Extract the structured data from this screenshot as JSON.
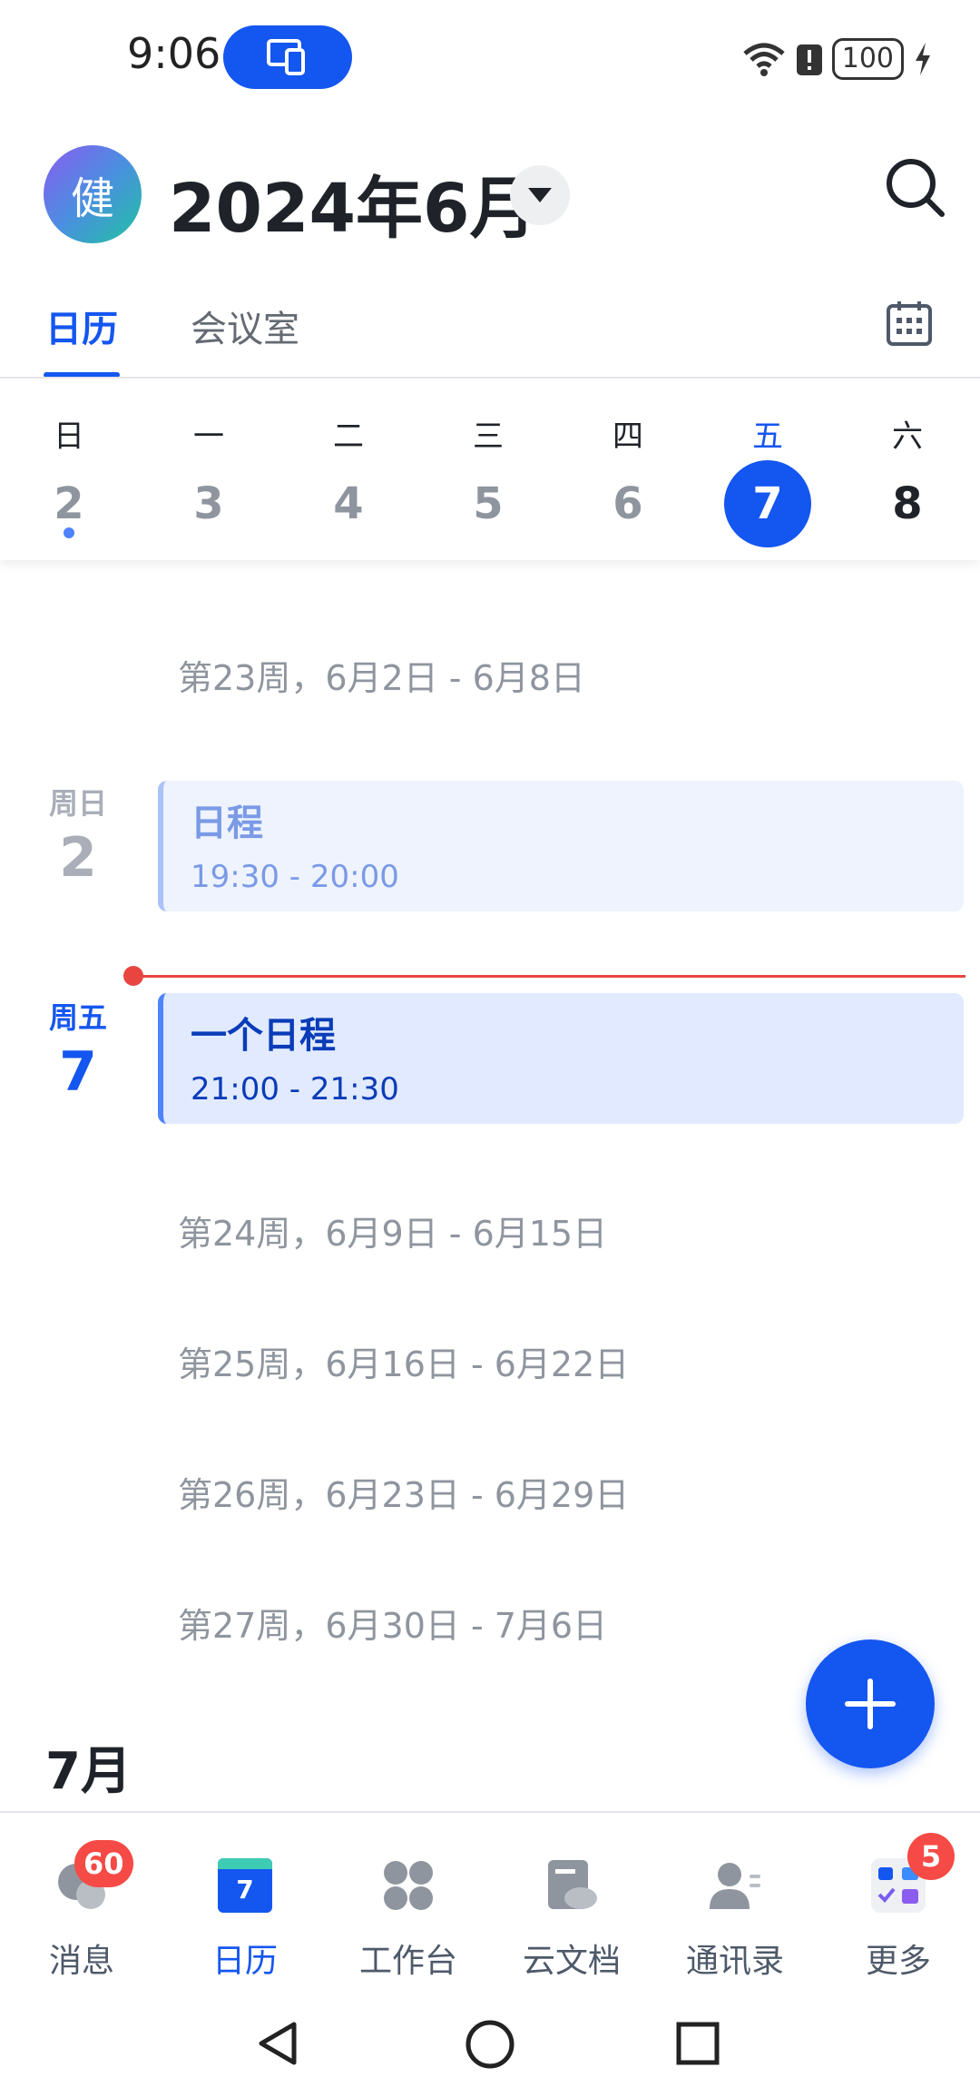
{
  "status_bar": {
    "time": "9:06",
    "battery": "100",
    "icons": [
      "screen-cast-icon",
      "wifi-icon",
      "alert-icon",
      "battery-icon",
      "charging-icon"
    ]
  },
  "header": {
    "avatar_text": "健",
    "month_title": "2024年6月",
    "dropdown_icon": "caret-down-icon",
    "search_icon": "search-icon"
  },
  "tabs": {
    "calendar": "日历",
    "meeting_room": "会议室",
    "calendar_view_icon": "calendar-grid-icon"
  },
  "week_strip": {
    "days": [
      {
        "name": "日",
        "num": "2",
        "has_event": true
      },
      {
        "name": "一",
        "num": "3"
      },
      {
        "name": "二",
        "num": "4"
      },
      {
        "name": "三",
        "num": "5"
      },
      {
        "name": "四",
        "num": "6"
      },
      {
        "name": "五",
        "num": "7",
        "selected": true
      },
      {
        "name": "六",
        "num": "8"
      }
    ]
  },
  "timeline": {
    "week23": "第23周，6月2日 - 6月8日",
    "sunday": {
      "weekday": "周日",
      "num": "2"
    },
    "event1": {
      "title": "日程",
      "time": "19:30 - 20:00"
    },
    "friday": {
      "weekday": "周五",
      "num": "7"
    },
    "event2": {
      "title": "一个日程",
      "time": "21:00 - 21:30"
    },
    "week24": "第24周，6月9日 - 6月15日",
    "week25": "第25周，6月16日 - 6月22日",
    "week26": "第26周，6月23日 - 6月29日",
    "week27": "第27周，6月30日 - 7月6日",
    "next_month": "7月"
  },
  "bottom_nav": {
    "messages": {
      "label": "消息",
      "badge": "60"
    },
    "calendar": {
      "label": "日历",
      "icon_num": "7"
    },
    "workplace": {
      "label": "工作台"
    },
    "docs": {
      "label": "云文档"
    },
    "contacts": {
      "label": "通讯录"
    },
    "more": {
      "label": "更多",
      "badge": "5"
    }
  },
  "colors": {
    "accent": "#1456f0",
    "badge": "#f54a45",
    "now_line": "#e84540"
  }
}
